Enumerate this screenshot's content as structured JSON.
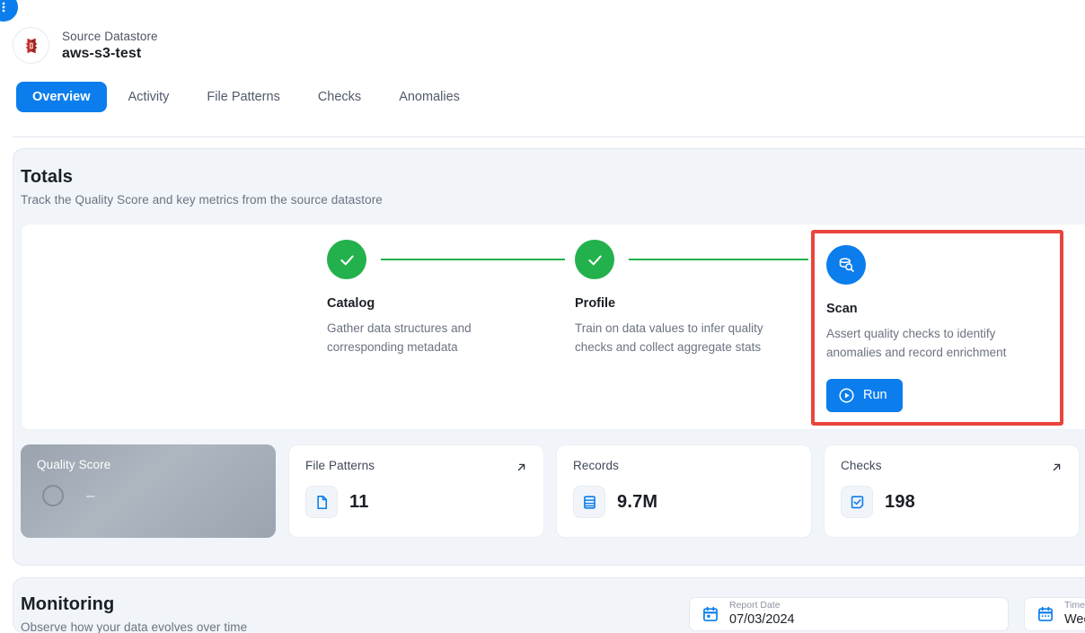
{
  "corner": {
    "icon": "more-vertical-icon"
  },
  "header": {
    "kind_label": "Source Datastore",
    "name": "aws-s3-test",
    "avatar_icon": "aws-s3-bucket-icon"
  },
  "tabs": [
    {
      "label": "Overview",
      "active": true
    },
    {
      "label": "Activity",
      "active": false
    },
    {
      "label": "File Patterns",
      "active": false
    },
    {
      "label": "Checks",
      "active": false
    },
    {
      "label": "Anomalies",
      "active": false
    }
  ],
  "totals": {
    "title": "Totals",
    "subtitle": "Track the Quality Score and key metrics from the source datastore",
    "steps": [
      {
        "name": "Catalog",
        "description": "Gather data structures and corresponding metadata",
        "state": "complete",
        "icon": "check-icon"
      },
      {
        "name": "Profile",
        "description": "Train on data values to infer quality checks and collect aggregate stats",
        "state": "complete",
        "icon": "check-icon"
      },
      {
        "name": "Scan",
        "description": "Assert quality checks to identify anomalies and record enrichment",
        "state": "pending",
        "icon": "database-scan-icon",
        "action_label": "Run",
        "action_icon": "play-circle-icon",
        "highlighted": true
      }
    ],
    "metrics": [
      {
        "label": "Quality Score",
        "value": "–",
        "icon": "score-ring-icon",
        "has_link_arrow": false,
        "variant": "quality"
      },
      {
        "label": "File Patterns",
        "value": "11",
        "icon": "file-icon",
        "has_link_arrow": true,
        "variant": "default"
      },
      {
        "label": "Records",
        "value": "9.7M",
        "icon": "records-icon",
        "has_link_arrow": false,
        "variant": "default"
      },
      {
        "label": "Checks",
        "value": "198",
        "icon": "check-square-icon",
        "has_link_arrow": true,
        "variant": "default"
      }
    ]
  },
  "monitoring": {
    "title": "Monitoring",
    "subtitle": "Observe how your data evolves over time",
    "report_date": {
      "label": "Report Date",
      "value": "07/03/2024",
      "icon": "calendar-icon"
    },
    "timeframe": {
      "label": "Timefr",
      "value": "Week",
      "icon": "calendar-range-icon"
    }
  },
  "colors": {
    "accent_blue": "#0b7ded",
    "success_green": "#23b14d",
    "highlight_red": "#e8453c",
    "panel_bg": "#f1f5f9",
    "s3_red": "#c4312a"
  }
}
